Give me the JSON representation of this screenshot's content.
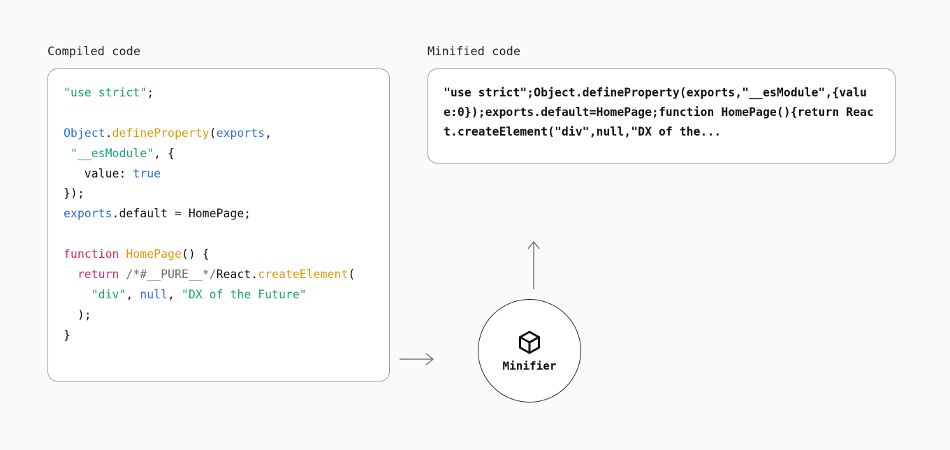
{
  "left": {
    "label": "Compiled code",
    "tokens": [
      {
        "t": "\"use strict\"",
        "c": "tok-str"
      },
      {
        "t": ";\n\n"
      },
      {
        "t": "Object",
        "c": "tok-obj"
      },
      {
        "t": "."
      },
      {
        "t": "defineProperty",
        "c": "tok-fn"
      },
      {
        "t": "("
      },
      {
        "t": "exports",
        "c": "tok-obj"
      },
      {
        "t": ",\n "
      },
      {
        "t": "\"__esModule\"",
        "c": "tok-str"
      },
      {
        "t": ", {\n"
      },
      {
        "t": "   value: "
      },
      {
        "t": "true",
        "c": "tok-obj"
      },
      {
        "t": "\n"
      },
      {
        "t": "});\n"
      },
      {
        "t": "exports",
        "c": "tok-obj"
      },
      {
        "t": ".default = HomePage;\n\n"
      },
      {
        "t": "function",
        "c": "tok-kw"
      },
      {
        "t": " "
      },
      {
        "t": "HomePage",
        "c": "tok-fn"
      },
      {
        "t": "() {\n"
      },
      {
        "t": "  "
      },
      {
        "t": "return",
        "c": "tok-kw"
      },
      {
        "t": " "
      },
      {
        "t": "/*#__PURE__*/",
        "c": "tok-comment"
      },
      {
        "t": "React."
      },
      {
        "t": "createElement",
        "c": "tok-fn"
      },
      {
        "t": "(\n"
      },
      {
        "t": "    "
      },
      {
        "t": "\"div\"",
        "c": "tok-str"
      },
      {
        "t": ", "
      },
      {
        "t": "null",
        "c": "tok-obj"
      },
      {
        "t": ", "
      },
      {
        "t": "\"DX of the Future\"",
        "c": "tok-str"
      },
      {
        "t": "\n"
      },
      {
        "t": "  );\n"
      },
      {
        "t": "}"
      }
    ]
  },
  "right": {
    "label": "Minified code",
    "code": "\"use strict\";Object.defineProperty(exports,\"__esModule\",{value:0});exports.default=HomePage;function HomePage(){return React.createElement(\"div\",null,\"DX of the..."
  },
  "minifier": {
    "label": "Minifier"
  }
}
